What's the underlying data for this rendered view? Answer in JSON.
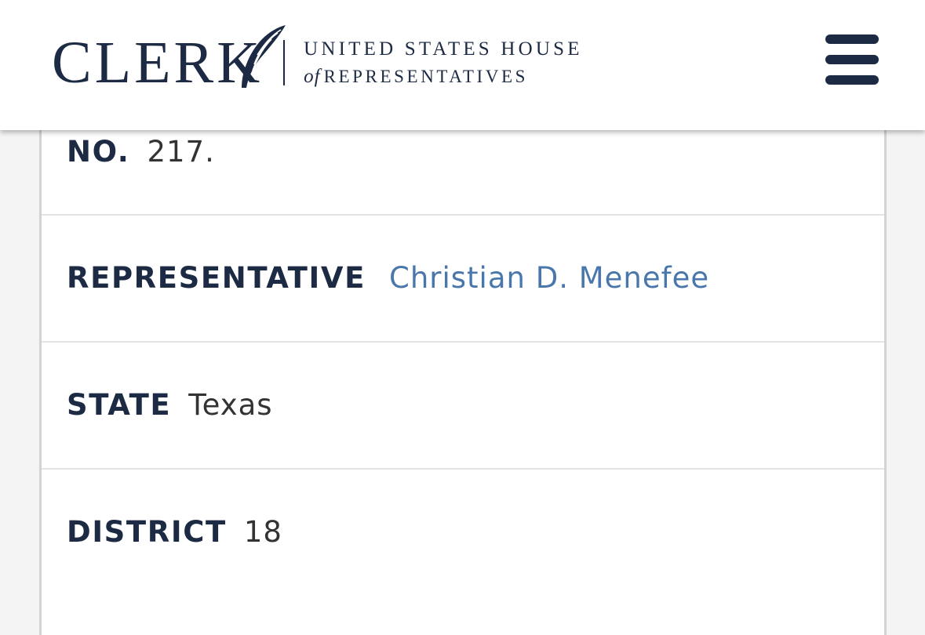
{
  "header": {
    "logo_word": "CLERK",
    "logo_line1": "UNITED STATES HOUSE",
    "logo_line2_of": "of",
    "logo_line2_rest": "REPRESENTATIVES",
    "menu_icon": "hamburger-menu-icon"
  },
  "record": {
    "number": {
      "label": "NO.",
      "value": "217."
    },
    "representative": {
      "label": "REPRESENTATIVE",
      "value": "Christian D. Menefee"
    },
    "state": {
      "label": "STATE",
      "value": "Texas"
    },
    "district": {
      "label": "DISTRICT",
      "value": "18"
    }
  },
  "colors": {
    "navy": "#1c2a44",
    "link": "#4a77ab",
    "divider": "#e3e3e3",
    "background": "#f4f4f4"
  }
}
